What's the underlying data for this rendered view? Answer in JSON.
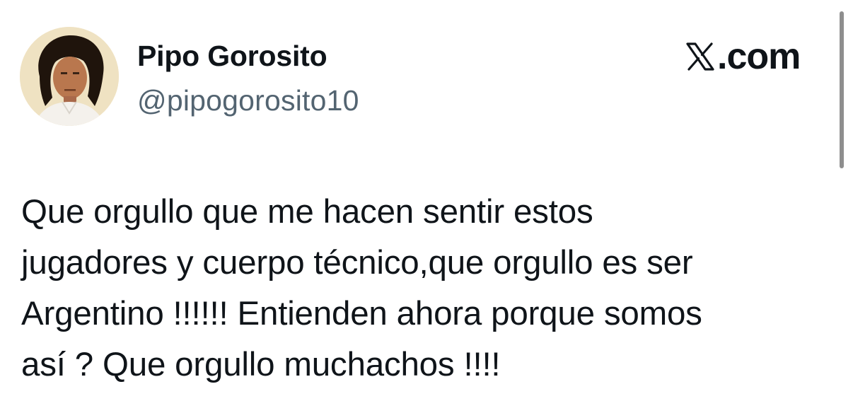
{
  "tweet": {
    "display_name": "Pipo Gorosito",
    "handle": "@pipogorosito10",
    "text": "Que orgullo que me hacen sentir estos\njugadores y cuerpo técnico,que orgullo es ser\nArgentino !!!!!! Entienden ahora porque somos\nasí ? Que orgullo muchachos !!!!"
  },
  "site": {
    "logo_icon": "x-logo-icon",
    "label": ".com"
  },
  "colors": {
    "text_primary": "#0f1419",
    "text_secondary": "#536471",
    "background": "#ffffff",
    "scrollbar": "#8e8e8e"
  }
}
